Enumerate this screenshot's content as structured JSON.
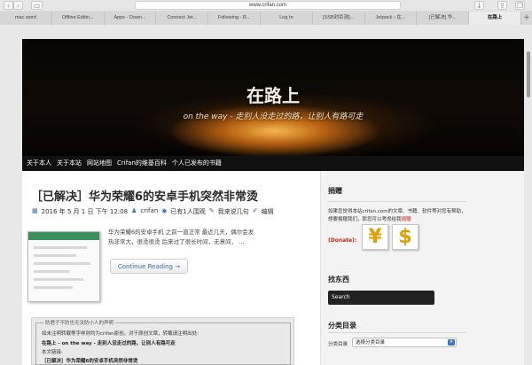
{
  "browser": {
    "url": "www.crifan.com",
    "tabs": [
      "mac word",
      "Offline Editin...",
      "Apps - Down...",
      "Connect Jet...",
      "Following - R...",
      "Log In",
      "[SSB封杀测]...",
      "Jetpack ‹ 在...",
      "[已解决] 华...",
      "在路上"
    ],
    "active_tab_index": 9
  },
  "site": {
    "title": "在路上",
    "tagline": "on the way - 走别人没走过的路，让别人有路可走",
    "menu": [
      "关于本人",
      "关于本站",
      "网站地图",
      "Crifan的维基百科",
      "个人已发布的书籍"
    ]
  },
  "post": {
    "title": "［已解决］华为荣耀6的安卓手机突然非常烫",
    "date": "2016 年 5 月 1 日 下午 12:08",
    "author": "crifan",
    "views": "已有1人围观",
    "comment": "我来说几句",
    "edit": "编辑",
    "excerpt": "华为荣耀6的安卓手机 之前一直正常 最近几天，偶尔会发热非常大，很烫很烫 后来过了很长时间，无意间， …",
    "read_more": "Continue Reading →"
  },
  "notice": {
    "legend": "防君子不防也无法防小人的声明",
    "line1": "如未注明转载等字样则均为crifan原创。对于原创文章，转载请注明出处:",
    "site_line": "在路上 - on the way - 走别人没走过的路，让别人有路可走",
    "link_label": "本文链接:",
    "link_title": "［已解决］华为荣耀6的安卓手机突然非常烫"
  },
  "sidebar": {
    "donate_heading": "捐赠",
    "donate_text": "如果您觉得本站crifan.com的文章、书籍、软件等对您有帮助，想要捐赠我们，那您可以考虑给我",
    "donate_emph": "捐赠",
    "donate_label": "(Donate):",
    "coin_yuan": "¥",
    "coin_dollar": "$",
    "find_heading": "找东西",
    "search_placeholder": "Search",
    "cat_heading": "分类目录",
    "cat_label": "分类目录",
    "cat_select": "选择分类目录"
  }
}
